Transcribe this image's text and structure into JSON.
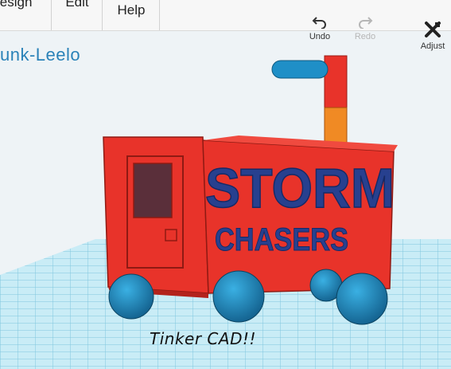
{
  "menu": {
    "items": [
      {
        "label": "Design"
      },
      {
        "label": "Edit"
      },
      {
        "label": "Help"
      }
    ]
  },
  "document": {
    "title": "unk-Leelo"
  },
  "toolbar": {
    "undo_label": "Undo",
    "redo_label": "Redo",
    "adjust_label": "Adjust"
  },
  "model": {
    "line1": "STORM",
    "line2": "CHASERS",
    "body_color": "#e8332a",
    "text_color": "#27408f",
    "wheel_color": "#1f8fc7",
    "chimney_color": "#f08a24",
    "grid_color": "#9fd8ea"
  },
  "caption": "Tinker CAD!!"
}
